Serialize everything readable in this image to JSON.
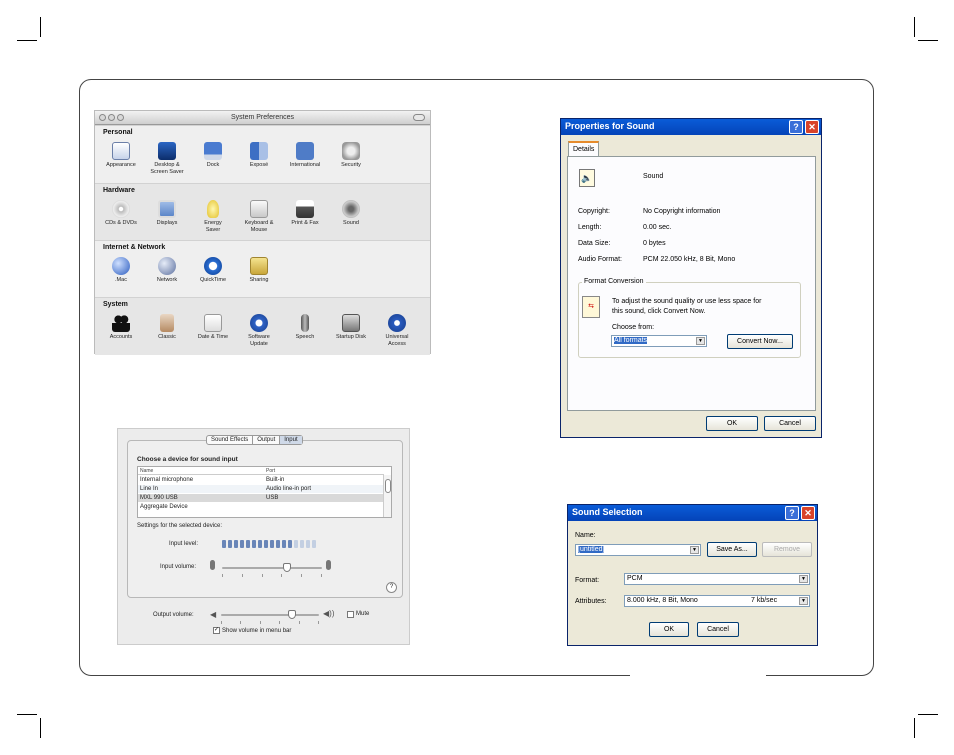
{
  "sysprefs": {
    "title": "System Preferences",
    "sections": [
      {
        "title": "Personal",
        "items": [
          "Appearance",
          "Desktop & Screen Saver",
          "Dock",
          "Exposé",
          "International",
          "Security"
        ]
      },
      {
        "title": "Hardware",
        "items": [
          "CDs & DVDs",
          "Displays",
          "Energy Saver",
          "Keyboard & Mouse",
          "Print & Fax",
          "Sound"
        ]
      },
      {
        "title": "Internet & Network",
        "items": [
          ".Mac",
          "Network",
          "QuickTime",
          "Sharing"
        ]
      },
      {
        "title": "System",
        "items": [
          "Accounts",
          "Classic",
          "Date & Time",
          "Software Update",
          "Speech",
          "Startup Disk",
          "Universal Access"
        ]
      }
    ],
    "item_labels": {
      "appearance": "Appearance",
      "desktop": "Desktop &",
      "desktop2": "Screen Saver",
      "dock": "Dock",
      "expose": "Exposé",
      "international": "International",
      "security": "Security",
      "cds": "CDs & DVDs",
      "displays": "Displays",
      "energy": "Energy",
      "energy2": "Saver",
      "keyboard": "Keyboard &",
      "keyboard2": "Mouse",
      "print": "Print & Fax",
      "sound": "Sound",
      "mac": ".Mac",
      "network": "Network",
      "quicktime": "QuickTime",
      "sharing": "Sharing",
      "accounts": "Accounts",
      "classic": "Classic",
      "datetime": "Date & Time",
      "swupdate": "Software",
      "swupdate2": "Update",
      "speech": "Speech",
      "startup": "Startup Disk",
      "universal": "Universal",
      "universal2": "Access"
    }
  },
  "sound_pane": {
    "tabs": [
      "Sound Effects",
      "Output",
      "Input"
    ],
    "active_tab": "Input",
    "heading": "Choose a device for sound input",
    "columns": [
      "Name",
      "Port"
    ],
    "devices": [
      {
        "name": "Internal microphone",
        "port": "Built-in"
      },
      {
        "name": "Line In",
        "port": "Audio line-in port"
      },
      {
        "name": "MXL 990 USB",
        "port": "USB"
      },
      {
        "name": "Aggregate Device",
        "port": ""
      }
    ],
    "selected_device": "MXL 990 USB",
    "settings_label": "Settings for the selected device:",
    "input_level_label": "Input level:",
    "input_level_lit": 12,
    "input_level_total": 16,
    "input_volume_label": "Input volume:",
    "input_volume": 0.65,
    "help": "?",
    "output_volume_label": "Output volume:",
    "output_volume": 0.72,
    "mute_label": "Mute",
    "show_volume_label": "Show volume in menu bar",
    "show_volume_checked": true
  },
  "properties": {
    "title": "Properties for Sound",
    "help_btn": "?",
    "close_btn": "✕",
    "tab": "Details",
    "name": "Sound",
    "fields": [
      {
        "label": "Copyright:",
        "value": "No Copyright information"
      },
      {
        "label": "Length:",
        "value": "0.00 sec."
      },
      {
        "label": "Data Size:",
        "value": "0 bytes"
      },
      {
        "label": "Audio Format:",
        "value": "PCM 22.050 kHz, 8 Bit, Mono"
      }
    ],
    "group_title": "Format Conversion",
    "conversion_text_1": "To adjust the sound quality or use less space for",
    "conversion_text_2": "this sound, click Convert Now.",
    "choose_from_label": "Choose from:",
    "choose_from_value": "All formats",
    "convert_btn": "Convert Now...",
    "ok_btn": "OK",
    "cancel_btn": "Cancel"
  },
  "sound_selection": {
    "title": "Sound Selection",
    "help_btn": "?",
    "close_btn": "✕",
    "name_label": "Name:",
    "name_value": "[untitled]",
    "save_as_btn": "Save As...",
    "remove_btn": "Remove",
    "format_label": "Format:",
    "format_value": "PCM",
    "attributes_label": "Attributes:",
    "attributes_value": "8.000 kHz, 8 Bit, Mono",
    "attributes_rate": "7 kb/sec",
    "ok_btn": "OK",
    "cancel_btn": "Cancel"
  },
  "colors": {
    "xp_title": "#0a5cd8",
    "xp_face": "#ece9d8",
    "mac_meter": "#6a86b8"
  }
}
